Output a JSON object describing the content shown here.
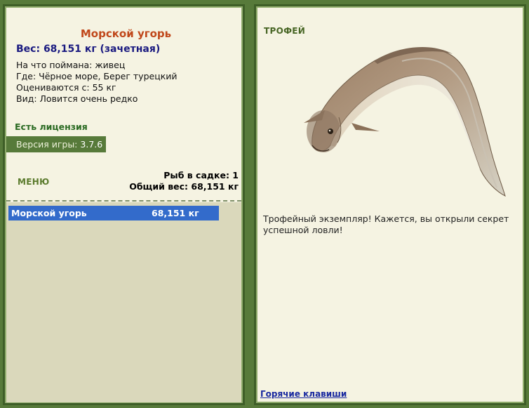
{
  "catch": {
    "fish_name": "Морской угорь",
    "weight": "Вес: 68,151 кг (зачетная)",
    "bait": "На что поймана: живец",
    "location": "Где: Чёрное море, Берег турецкий",
    "value": "Оцениваются с: 55 кг",
    "rarity": "Вид: Ловится очень редко"
  },
  "license": "Есть лицензия",
  "version": {
    "label": "Версия игры:",
    "number": "3.7.6"
  },
  "menu_label": "МЕНЮ",
  "keepnet": {
    "count": "Рыб в садке: 1",
    "total_weight": "Общий вес: 68,151 кг"
  },
  "keepnet_list": [
    {
      "name": "Морской угорь",
      "weight": "68,151 кг"
    }
  ],
  "trophy": {
    "label": "ТРОФЕЙ",
    "description": "Трофейный экземпляр! Кажется, вы открыли секрет успешной ловли!"
  },
  "hotkeys_link": "Горячие клавиши",
  "colors": {
    "frame": "#577a3a",
    "panel_bg": "#f5f3e2",
    "title": "#c0471a",
    "weight": "#1a1a80",
    "selected_row": "#336bcb",
    "list_bg": "#dad8bb"
  }
}
